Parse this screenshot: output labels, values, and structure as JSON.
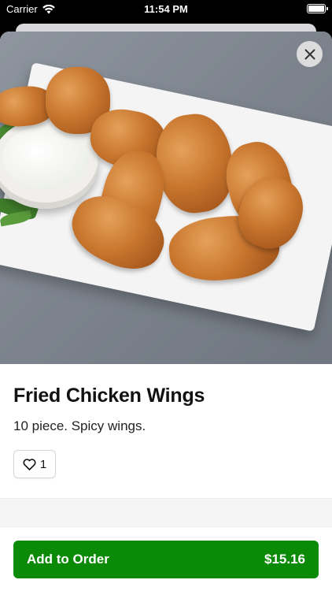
{
  "status_bar": {
    "carrier": "Carrier",
    "time": "11:54 PM"
  },
  "item": {
    "title": "Fried Chicken Wings",
    "description": "10 piece. Spicy wings.",
    "favorite_count": "1",
    "image_alt": "fried chicken wings on a plate with dipping sauce"
  },
  "actions": {
    "add_label": "Add to Order",
    "price": "$15.16"
  },
  "colors": {
    "primary": "#0a8a07",
    "close_bg": "#dcdcdc"
  },
  "icons": [
    "wifi-icon",
    "battery-icon",
    "close-icon",
    "heart-icon"
  ]
}
